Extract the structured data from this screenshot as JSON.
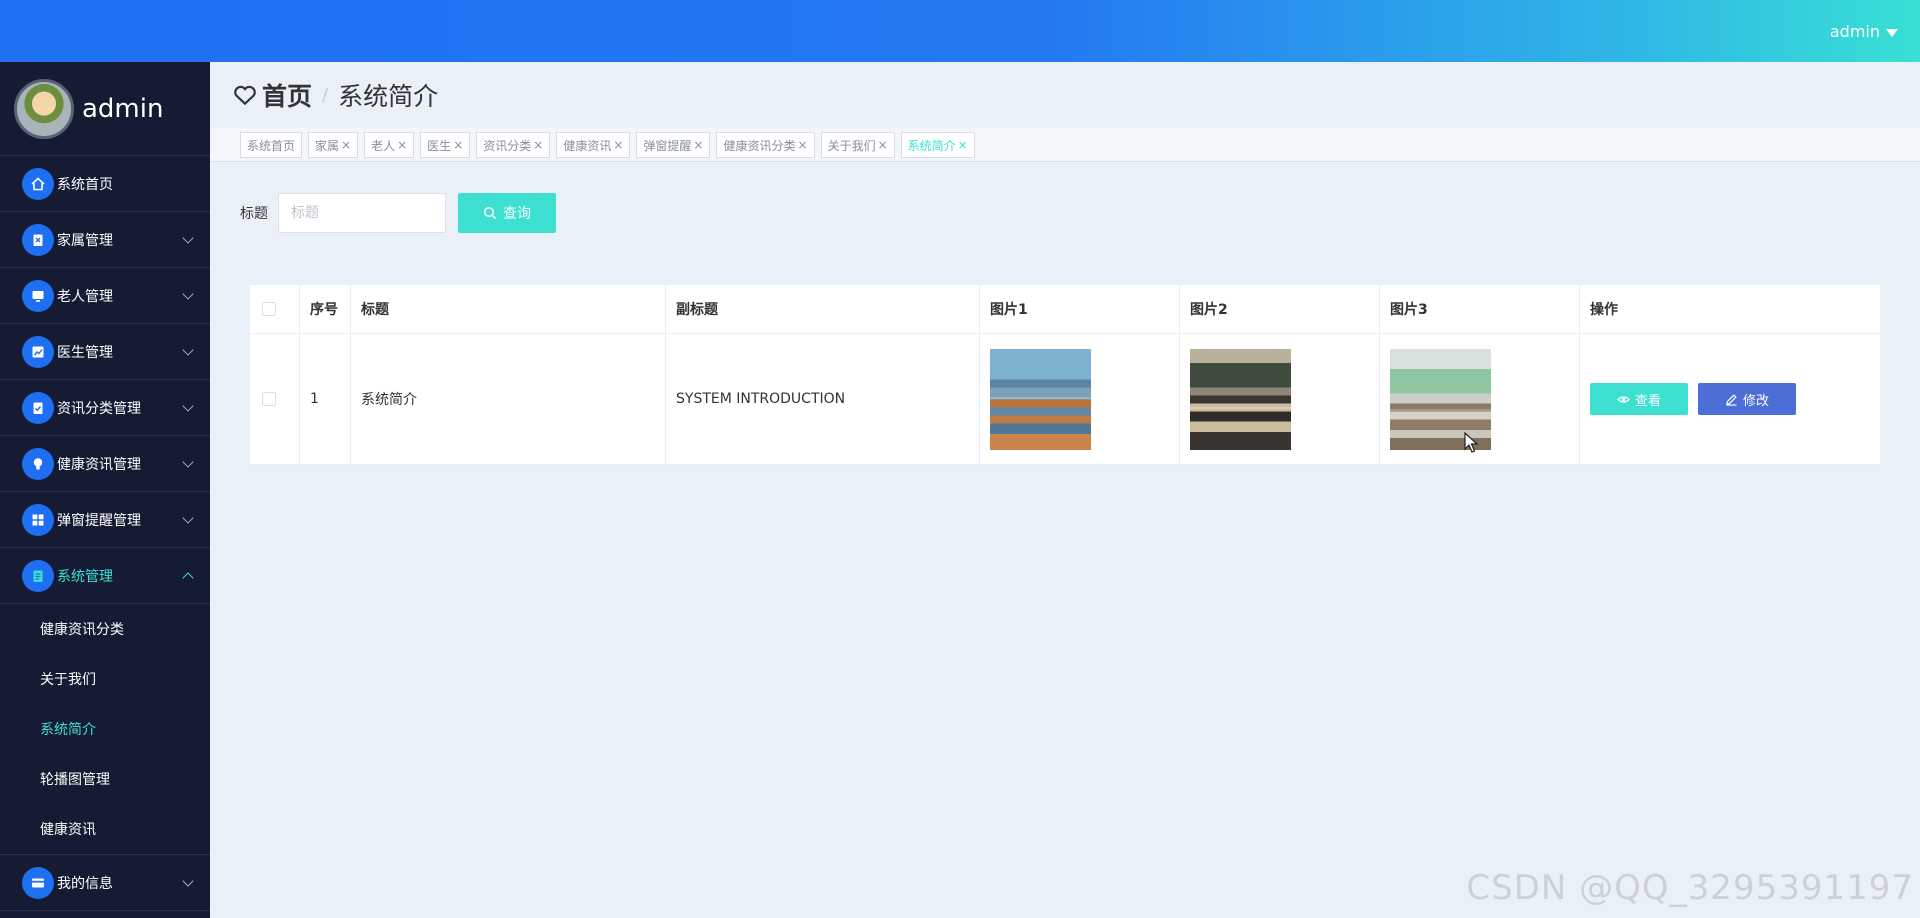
{
  "topbar": {
    "user": "admin"
  },
  "sidebar": {
    "username": "admin",
    "items": [
      {
        "label": "系统首页",
        "icon": "home-icon",
        "expandable": false
      },
      {
        "label": "家属管理",
        "icon": "clipboard-icon",
        "expandable": true
      },
      {
        "label": "老人管理",
        "icon": "monitor-icon",
        "expandable": true
      },
      {
        "label": "医生管理",
        "icon": "chart-icon",
        "expandable": true
      },
      {
        "label": "资讯分类管理",
        "icon": "checklist-icon",
        "expandable": true
      },
      {
        "label": "健康资讯管理",
        "icon": "bulb-icon",
        "expandable": true
      },
      {
        "label": "弹窗提醒管理",
        "icon": "grid-icon",
        "expandable": true
      },
      {
        "label": "系统管理",
        "icon": "document-icon",
        "expandable": true,
        "expanded": true
      },
      {
        "label": "我的信息",
        "icon": "card-icon",
        "expandable": true
      }
    ],
    "submenu": [
      "健康资讯分类",
      "关于我们",
      "系统简介",
      "轮播图管理",
      "健康资讯"
    ],
    "active_submenu": "系统简介"
  },
  "breadcrumb": {
    "home": "首页",
    "separator": "/",
    "current": "系统简介"
  },
  "tags": [
    "系统首页",
    "家属",
    "老人",
    "医生",
    "资讯分类",
    "健康资讯",
    "弹窗提醒",
    "健康资讯分类",
    "关于我们",
    "系统简介"
  ],
  "tag_close": "×",
  "search": {
    "label": "标题",
    "placeholder": "标题",
    "button": "查询"
  },
  "table": {
    "headers": [
      "序号",
      "标题",
      "副标题",
      "图片1",
      "图片2",
      "图片3",
      "操作"
    ],
    "rows": [
      {
        "index": "1",
        "title": "系统简介",
        "subtitle": "SYSTEM INTRODUCTION"
      }
    ],
    "actions": {
      "view": "查看",
      "edit": "修改"
    }
  },
  "colors": {
    "primary": "#1e6ff2",
    "accent": "#3de0d0",
    "sidebar_bg": "#151b33",
    "edit_button": "#4c6ed6"
  },
  "watermark": "CSDN @QQ_3295391197"
}
